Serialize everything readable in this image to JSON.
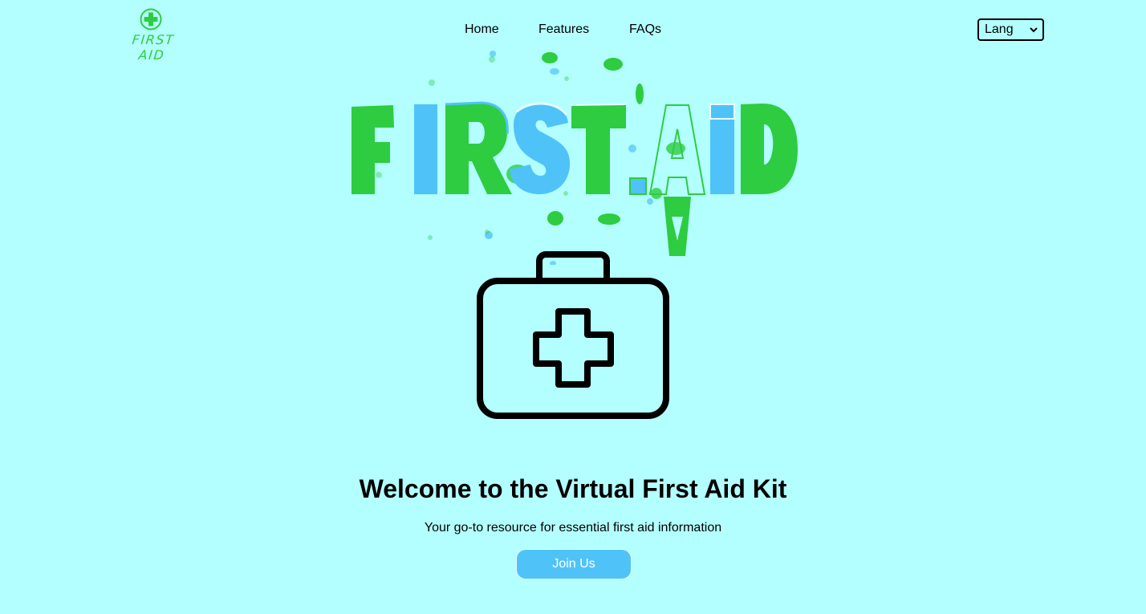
{
  "header": {
    "logo_text": "FIRST AID",
    "nav": [
      {
        "label": "Home"
      },
      {
        "label": "Features"
      },
      {
        "label": "FAQs"
      }
    ],
    "lang_select": {
      "selected": "Lang"
    }
  },
  "hero": {
    "art_text": "FIRST AID",
    "title": "Welcome to the Virtual First Aid Kit",
    "subtitle": "Your go-to resource for essential first aid information",
    "cta_label": "Join Us"
  },
  "colors": {
    "background": "#b3ffff",
    "brand_green": "#2ecc40",
    "brand_blue": "#4fc3f7",
    "text": "#000000"
  },
  "icons": [
    "plus-circle-icon",
    "first-aid-kit-icon",
    "chevron-down-icon"
  ]
}
